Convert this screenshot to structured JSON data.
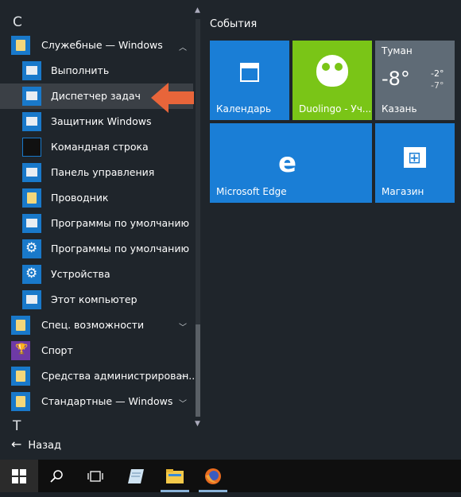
{
  "app_list": {
    "letter_c": "С",
    "letter_t": "Т",
    "items": [
      {
        "label": "Служебные — Windows",
        "chevron": "^",
        "kind": "folder"
      },
      {
        "label": "Выполнить",
        "kind": "app"
      },
      {
        "label": "Диспетчер задач",
        "kind": "app",
        "selected": true
      },
      {
        "label": "Защитник Windows",
        "kind": "app"
      },
      {
        "label": "Командная строка",
        "kind": "app"
      },
      {
        "label": "Панель управления",
        "kind": "app"
      },
      {
        "label": "Проводник",
        "kind": "app"
      },
      {
        "label": "Программы по умолчанию",
        "kind": "app"
      },
      {
        "label": "Программы по умолчанию",
        "kind": "app"
      },
      {
        "label": "Устройства",
        "kind": "app"
      },
      {
        "label": "Этот компьютер",
        "kind": "app"
      },
      {
        "label": "Спец. возможности",
        "chevron": "v",
        "kind": "folder"
      },
      {
        "label": "Спорт",
        "kind": "app"
      },
      {
        "label": "Средства администрирован...",
        "chevron": "v",
        "kind": "folder"
      },
      {
        "label": "Стандартные — Windows",
        "chevron": "v",
        "kind": "folder"
      }
    ],
    "back_label": "Назад"
  },
  "tiles": {
    "group_title": "События",
    "calendar": "Календарь",
    "duolingo": "Duolingo - Уч...",
    "weather": {
      "city": "Туман",
      "temp": "-8°",
      "high": "-2°",
      "low": "-7°",
      "place": "Казань"
    },
    "edge": "Microsoft Edge",
    "store": "Магазин"
  },
  "colors": {
    "accent": "#1979ca",
    "duolingo": "#7ac517",
    "weather": "#5f6b76",
    "arrow": "#e8653a"
  },
  "icons": [
    "windows-logo-icon",
    "search-icon",
    "task-view-icon",
    "notepad-icon",
    "file-explorer-icon",
    "firefox-icon"
  ]
}
